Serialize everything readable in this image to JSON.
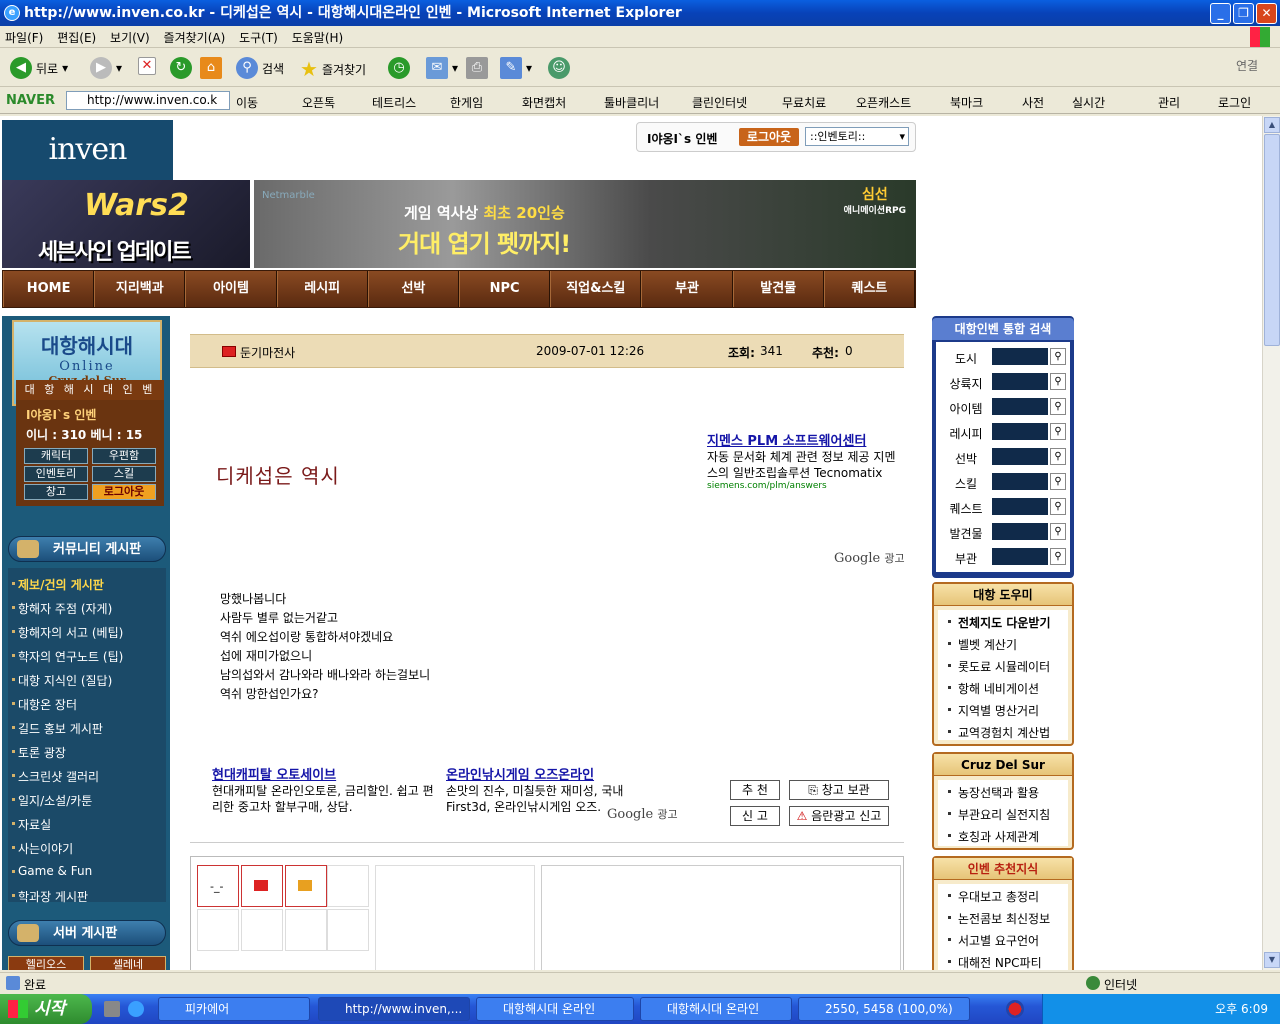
{
  "window": {
    "title": "http://www.inven.co.kr - 디케섭은 역시 - 대항해시대온라인 인벤 - Microsoft Internet Explorer"
  },
  "menubar": [
    "파일(F)",
    "편집(E)",
    "보기(V)",
    "즐겨찾기(A)",
    "도구(T)",
    "도움말(H)"
  ],
  "toolbar": {
    "back": "뒤로",
    "search": "검색",
    "favorites": "즐겨찾기",
    "links": "연결"
  },
  "naverbar": {
    "brand": "NAVER",
    "address": "http://www.inven.co.k",
    "go": "이동",
    "items": [
      "오픈톡",
      "테트리스",
      "한게임",
      "화면캡처",
      "툴바클리너",
      "클린인터넷",
      "무료치료",
      "오픈캐스트",
      "북마크",
      "사전",
      "실시간",
      "관리",
      "로그인"
    ]
  },
  "header": {
    "logo": "inven",
    "username": "I야옹I`s 인벤",
    "logout": "로그아웃",
    "select": "::인벤토리::"
  },
  "banners": {
    "left_logo": "Wars2",
    "left": "세븐사인 업데이트",
    "right_brand": "Netmarble",
    "right_line1a": "게임 역사상 ",
    "right_line1b": "최초 20인승",
    "right_line2": "거대 엽기 펫까지!",
    "right_game": "심선",
    "right_game_sub": "애니메이션RPG"
  },
  "nav": [
    "HOME",
    "지리백과",
    "아이템",
    "레시피",
    "선박",
    "NPC",
    "직업&스킬",
    "부관",
    "발견물",
    "퀘스트"
  ],
  "left": {
    "game_title": "대항해시대",
    "game_sub": "Online",
    "game_sub2": "Cruz del Sur",
    "bar": "대 항 해 시 대 인 벤",
    "user": "I야옹I`s 인벤",
    "points": "이니 : 310   베니 : 15",
    "buttons": [
      "캐릭터",
      "우편함",
      "인벤토리",
      "스킬",
      "창고",
      "로그아웃"
    ],
    "community_header": "커뮤니티 게시판",
    "menu": [
      "제보/건의 게시판",
      "항해자 주점 (자게)",
      "항해자의 서고 (베팁)",
      "학자의 연구노트 (팁)",
      "대항 지식인 (질답)",
      "대항온 장터",
      "길드 홍보 게시판",
      "토론 광장",
      "스크린샷 갤러리",
      "일지/소설/카툰",
      "자료실",
      "사는이야기",
      "Game & Fun",
      "학과장 게시판"
    ],
    "server_header": "서버 게시판",
    "servers": [
      "헬리오스",
      "셀레네"
    ]
  },
  "article": {
    "author": "둔기마전사",
    "date": "2009-07-01 12:26",
    "views_label": "조회:",
    "views": "341",
    "recs_label": "추천:",
    "recs": "0",
    "title": "디케섭은 역시",
    "body": [
      "망했나봅니다",
      "사람두 별루 없는거같고",
      "역쉬 에오섭이랑 통합하셔야겠네요",
      "섭에 재미가없으니",
      "남의섭와서 감나와라 배나와라 하는걸보니",
      "역쉬 망한섭인가요?"
    ]
  },
  "ads": {
    "top": {
      "title": "지멘스 PLM 소프트웨어센터",
      "desc": "자동 문서화 체계 관련 정보 제공 지멘스의 일반조립솔루션 Tecnomatix",
      "url": "siemens.com/plm/answers"
    },
    "google_label": "Google",
    "google_suffix": "광고",
    "bottom1": {
      "title": "현대캐피탈 오토세이브",
      "desc": "현대캐피탈 온라인오토론, 금리할인. 쉽고 편리한 중고차 할부구매, 상담."
    },
    "bottom2": {
      "title": "온라인낚시게임 오즈온라인",
      "desc": "손맛의 진수, 미칠듯한 재미성, 국내 First3d, 온라인낚시게임 오즈."
    }
  },
  "actions": {
    "recommend": "추 천",
    "save": "창고 보관",
    "report": "신 고",
    "spam": "음란광고 신고"
  },
  "comment_cells": [
    "-_-",
    "",
    ""
  ],
  "right": {
    "search_header": "대항인벤 통합 검색",
    "search_rows": [
      "도시",
      "상륙지",
      "아이템",
      "레시피",
      "선박",
      "스킬",
      "퀘스트",
      "발견물",
      "부관"
    ],
    "helper_header": "대항 도우미",
    "helper": [
      "전체지도 다운받기",
      "벨벳 계산기",
      "롯도료 시뮬레이터",
      "항해 네비게이션",
      "지역별 명산거리",
      "교역경험치 계산법"
    ],
    "cruz_header": "Cruz Del Sur",
    "cruz": [
      "농장선택과 활용",
      "부관요리 실전지침",
      "호칭과 사제관계"
    ],
    "rec_header": "인벤 추천지식",
    "rec": [
      "우대보고 총정리",
      "논전콤보 최신정보",
      "서고별 요구언어",
      "대해전 NPC파티"
    ]
  },
  "status": {
    "left": "완료",
    "zone": "인터넷"
  },
  "taskbar": {
    "start": "시작",
    "tasks": [
      "피카에어",
      "http://www.inven,...",
      "대항해시대 온라인",
      "대항해시대 온라인",
      "2550, 5458 (100,0%)"
    ],
    "clock": "오후 6:09"
  }
}
